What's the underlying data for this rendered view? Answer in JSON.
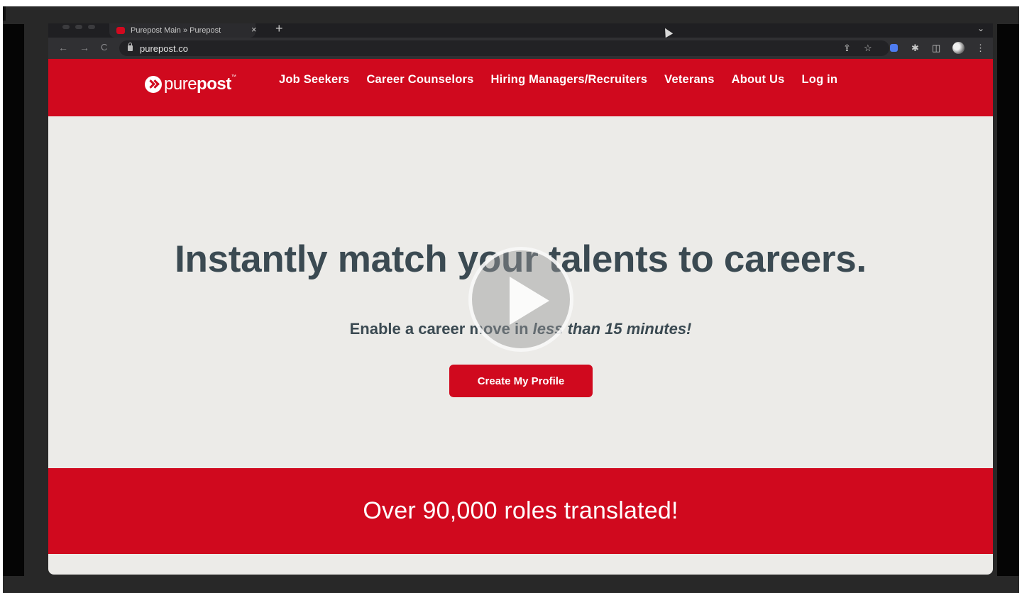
{
  "browser": {
    "tab_title": "Purepost Main » Purepost",
    "tab_close": "×",
    "new_tab": "+",
    "url": "purepost.co",
    "back": "←",
    "forward": "→",
    "reload": "C",
    "share": "⇪",
    "star": "☆",
    "puzzle": "✱",
    "sidepanel": "◫",
    "menu": "⋮",
    "chevron": "⌄"
  },
  "site": {
    "brand_color": "#d0091e",
    "logo_light": "pure",
    "logo_bold": "post",
    "logo_tm": "™",
    "nav": [
      "Job Seekers",
      "Career Counselors",
      "Hiring Managers/Recruiters",
      "Veterans",
      "About Us",
      "Log in"
    ]
  },
  "hero": {
    "title_strong": "Instantly",
    "title_rest": " match your talents to careers.",
    "subtitle_start": "Enable a career move in ",
    "subtitle_em": "less than 15 minutes!",
    "cta": "Create My Profile"
  },
  "banner": {
    "text": "Over 90,000 roles translated!"
  }
}
